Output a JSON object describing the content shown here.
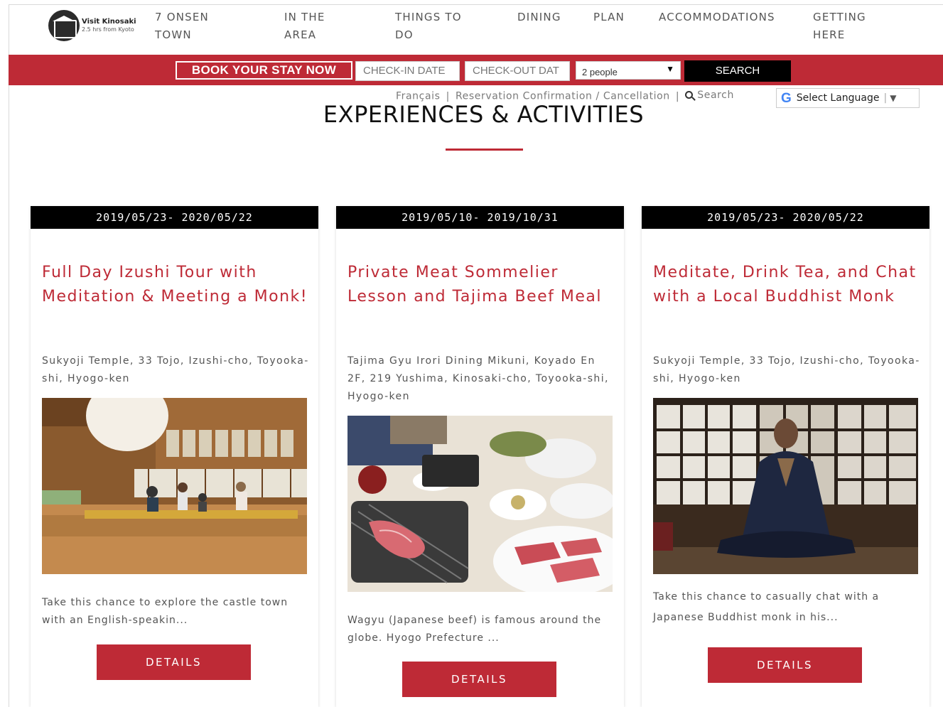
{
  "header": {
    "logo_title": "Visit Kinosaki",
    "logo_subtitle": "2.5 hrs from Kyoto",
    "nav": [
      {
        "line1": "7 ONSEN",
        "line2": "TOWN"
      },
      {
        "line1": "IN THE",
        "line2": "AREA"
      },
      {
        "line1": "THINGS TO",
        "line2": "DO"
      },
      {
        "line1": "DINING",
        "line2": ""
      },
      {
        "line1": "PLAN",
        "line2": ""
      },
      {
        "line1": "ACCOMMODATIONS",
        "line2": ""
      },
      {
        "line1": "GETTING",
        "line2": "HERE"
      }
    ]
  },
  "booking": {
    "book_label": "BOOK YOUR STAY NOW",
    "checkin_placeholder": "CHECK-IN DATE",
    "checkout_placeholder": "CHECK-OUT DAT",
    "people_value": "2 people",
    "search_label": "SEARCH",
    "bar_color": "#be2a36"
  },
  "utility": {
    "francais": "Français",
    "reservation": "Reservation Confirmation / Cancellation",
    "search": "Search",
    "select_language": "Select Language",
    "sep": "|"
  },
  "page": {
    "title": "EXPERIENCES & ACTIVITIES"
  },
  "cards": [
    {
      "date": "2019/05/23- 2020/05/22",
      "title": "Full Day Izushi Tour with Meditation & Meeting a Monk!",
      "address": "Sukyoji Temple, 33 Tojo, Izushi-cho, Toyooka-shi, Hyogo-ken",
      "image": "temple-meditation-hall-photo",
      "description": "Take this chance to explore the castle town with an English-speakin...",
      "button": "DETAILS"
    },
    {
      "date": "2019/05/10- 2019/10/31",
      "title": "Private Meat Sommelier Lesson and Tajima Beef Meal",
      "address": "Tajima Gyu Irori Dining Mikuni, Koyado En 2F, 219 Yushima, Kinosaki-cho, Toyooka-shi, Hyogo-ken",
      "image": "tajima-beef-grill-table-photo",
      "description": "Wagyu (Japanese beef) is famous around the globe. Hyogo Prefecture ...",
      "button": "DETAILS"
    },
    {
      "date": "2019/05/23- 2020/05/22",
      "title": "Meditate, Drink Tea, and Chat with a Local Buddhist Monk",
      "address": "Sukyoji Temple, 33 Tojo, Izushi-cho, Toyooka-shi, Hyogo-ken",
      "image": "meditating-monk-photo",
      "description": "Take this chance to casually chat with a Japanese Buddhist monk in his...",
      "button": "DETAILS"
    }
  ]
}
